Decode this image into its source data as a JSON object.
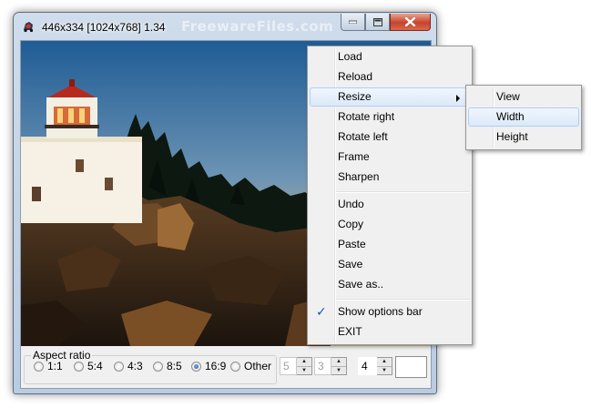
{
  "window": {
    "title": "446x334 [1024x768] 1.34",
    "watermark": "FreewareFiles.com",
    "icons": {
      "app": "car-icon",
      "minimize": "minimize-icon",
      "maximize": "maximize-icon",
      "close": "close-icon"
    }
  },
  "photo": {
    "subject": "lighthouse-photo"
  },
  "options_bar": {
    "aspect_label": "Aspect ratio",
    "ratios": [
      {
        "label": "1:1",
        "checked": false
      },
      {
        "label": "5:4",
        "checked": false
      },
      {
        "label": "4:3",
        "checked": false
      },
      {
        "label": "8:5",
        "checked": false
      },
      {
        "label": "16:9",
        "checked": true
      },
      {
        "label": "Other",
        "checked": false
      }
    ],
    "spin_a": "5",
    "spin_b": "3",
    "spin_c": "4"
  },
  "context_menu": {
    "items": [
      {
        "label": "Load"
      },
      {
        "label": "Reload"
      },
      {
        "label": "Resize",
        "submenu": true,
        "highlighted": true
      },
      {
        "label": "Rotate right"
      },
      {
        "label": "Rotate left"
      },
      {
        "label": "Frame"
      },
      {
        "label": "Sharpen"
      },
      {
        "label": "Undo"
      },
      {
        "label": "Copy"
      },
      {
        "label": "Paste"
      },
      {
        "label": "Save"
      },
      {
        "label": "Save as.."
      },
      {
        "label": "Show options bar",
        "checked": true
      },
      {
        "label": "EXIT"
      }
    ]
  },
  "submenu": {
    "items": [
      {
        "label": "View"
      },
      {
        "label": "Width",
        "highlighted": true
      },
      {
        "label": "Height"
      }
    ]
  },
  "colors": {
    "menu_highlight": "#dce9f8",
    "titlebar": "#b9cce2",
    "close_button": "#c7432b"
  }
}
